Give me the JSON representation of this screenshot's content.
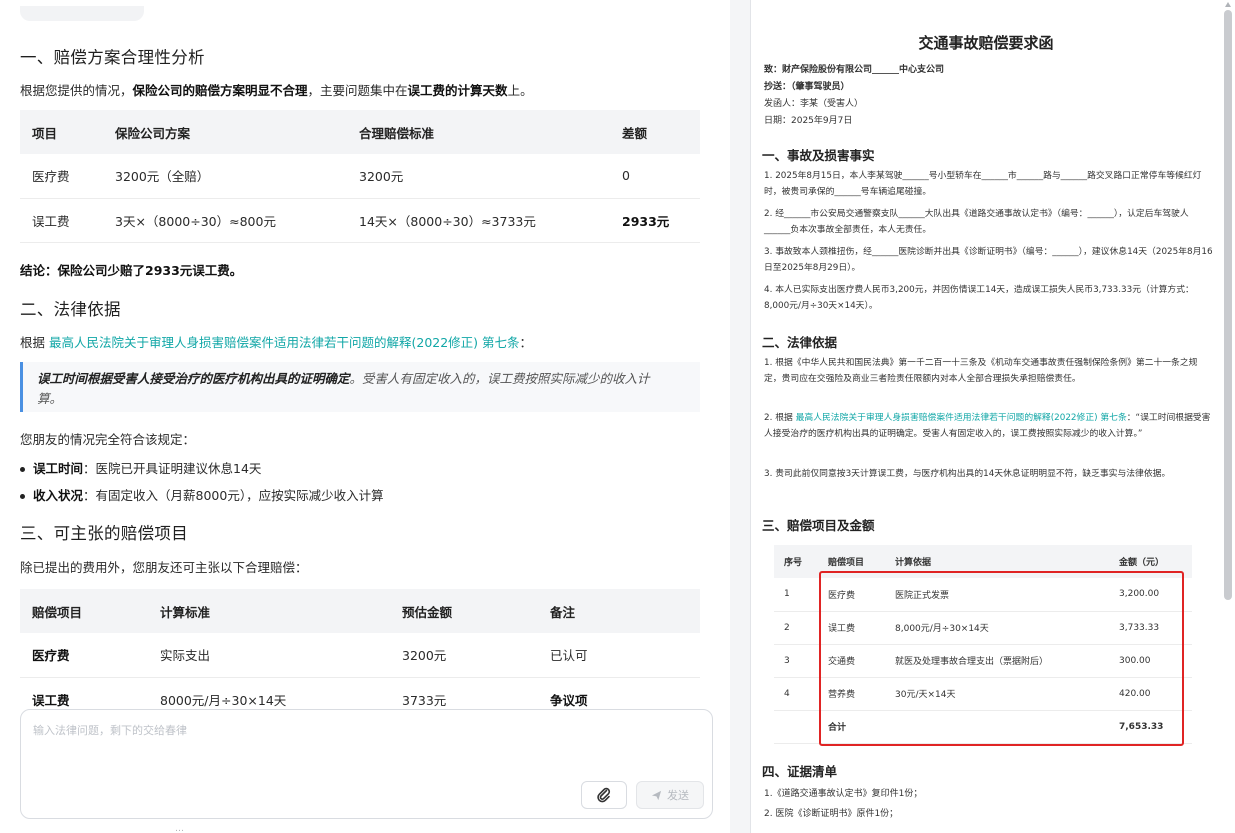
{
  "chat": {
    "section1": {
      "title": "一、赔偿方案合理性分析",
      "intro_pre": "根据您提供的情况，",
      "intro_bold1": "保险公司的赔偿方案明显不合理",
      "intro_mid": "，主要问题集中在",
      "intro_bold2": "误工费的计算天数",
      "intro_post": "上。",
      "table": {
        "headers": [
          "项目",
          "保险公司方案",
          "合理赔偿标准",
          "差额"
        ],
        "rows": [
          [
            "医疗费",
            "3200元（全赔）",
            "3200元",
            "0"
          ],
          [
            "误工费",
            "3天×（8000÷30）≈800元",
            "14天×（8000÷30）≈3733元",
            "2933元"
          ]
        ]
      },
      "conclusion": "结论：保险公司少赔了2933元误工费。"
    },
    "section2": {
      "title": "二、法律依据",
      "basis_pre": "根据 ",
      "basis_link": "最高人民法院关于审理人身损害赔偿案件适用法律若干问题的解释(2022修正) 第七条",
      "basis_post": "：",
      "quote_bold": "误工时间根据受害人接受治疗的医疗机构出具的证明确定",
      "quote_rest": "。受害人有固定收入的，误工费按照实际减少的收入计",
      "quote_line2": "算。",
      "fit": "您朋友的情况完全符合该规定：",
      "bullets": [
        {
          "label": "误工时间",
          "text": "：医院已开具证明建议休息14天"
        },
        {
          "label": "收入状况",
          "text": "：有固定收入（月薪8000元），应按实际减少收入计算"
        }
      ]
    },
    "section3": {
      "title": "三、可主张的赔偿项目",
      "intro": "除已提出的费用外，您朋友还可主张以下合理赔偿：",
      "table": {
        "headers": [
          "赔偿项目",
          "计算标准",
          "预估金额",
          "备注"
        ],
        "rows": [
          [
            "医疗费",
            "实际支出",
            "3200元",
            "已认可"
          ],
          [
            "误工费",
            "8000元/月÷30×14天",
            "3733元",
            "争议项"
          ]
        ]
      }
    },
    "composer": {
      "placeholder": "输入法律问题，剩下的交给春律",
      "send_label": "发送"
    },
    "footer_note": "…"
  },
  "doc": {
    "title": "交通事故赔偿要求函",
    "to": "致：财产保险股份有限公司______中心支公司",
    "cc": "抄送：（肇事驾驶员）",
    "from": "发函人：李某（受害人）",
    "date": "日期：2025年9月7日",
    "s1": {
      "title": "一、事故及损害事实",
      "items": [
        "1. 2025年8月15日，本人李某驾驶______号小型轿车在______市______路与______路交叉路口正常停车等候红灯时，被贵司承保的______号车辆追尾碰撞。",
        "2. 经______市公安局交通警察支队______大队出具《道路交通事故认定书》（编号：______），认定后车驾驶人______负本次事故全部责任，本人无责任。",
        "3. 事故致本人颈椎扭伤，经______医院诊断并出具《诊断证明书》（编号：______），建议休息14天（2025年8月16日至2025年8月29日）。",
        "4. 本人已实际支出医疗费人民币3,200元，并因伤情误工14天，造成误工损失人民币3,733.33元（计算方式：8,000元/月÷30天×14天）。"
      ]
    },
    "s2": {
      "title": "二、法律依据",
      "item1": "1. 根据《中华人民共和国民法典》第一千二百一十三条及《机动车交通事故责任强制保险条例》第二十一条之规定，贵司应在交强险及商业三者险责任限额内对本人全部合理损失承担赔偿责任。",
      "item2_pre": "2. 根据 ",
      "item2_link": "最高人民法院关于审理人身损害赔偿案件适用法律若干问题的解释(2022修正) 第七条",
      "item2_post": "：“误工时间根据受害人接受治疗的医疗机构出具的证明确定。受害人有固定收入的，误工费按照实际减少的收入计算。”",
      "item3": "3. 贵司此前仅同意按3天计算误工费，与医疗机构出具的14天休息证明明显不符，缺乏事实与法律依据。"
    },
    "s3": {
      "title": "三、赔偿项目及金额",
      "headers": [
        "序号",
        "赔偿项目",
        "计算依据",
        "金额（元）"
      ],
      "rows": [
        [
          "1",
          "医疗费",
          "医院正式发票",
          "3,200.00"
        ],
        [
          "2",
          "误工费",
          "8,000元/月÷30×14天",
          "3,733.33"
        ],
        [
          "3",
          "交通费",
          "就医及处理事故合理支出（票据附后）",
          "300.00"
        ],
        [
          "4",
          "营养费",
          "30元/天×14天",
          "420.00"
        ]
      ],
      "total_label": "合计",
      "total_value": "7,653.33"
    },
    "s4": {
      "title": "四、证据清单",
      "items": [
        "1.《道路交通事故认定书》复印件1份；",
        "2. 医院《诊断证明书》原件1份；"
      ]
    }
  }
}
